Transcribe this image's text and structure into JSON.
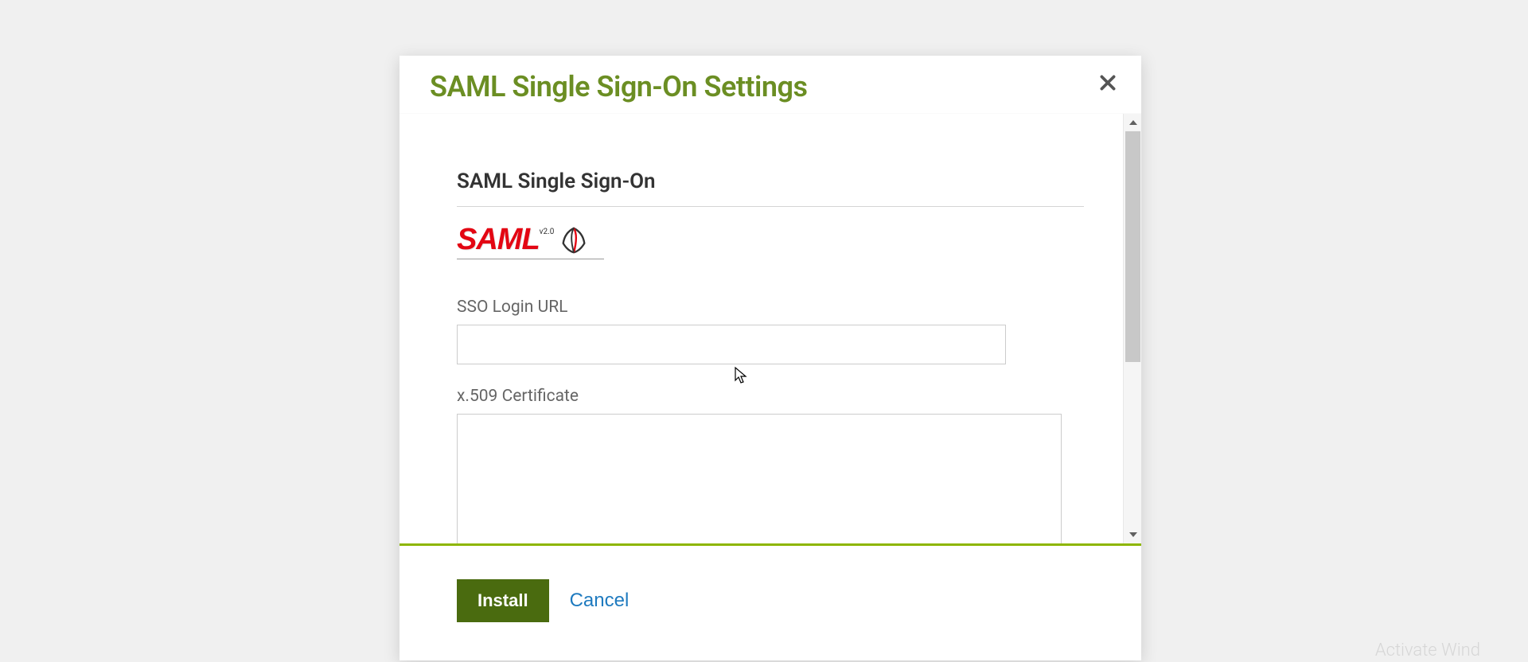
{
  "modal": {
    "title": "SAML Single Sign-On Settings",
    "section_title": "SAML Single Sign-On",
    "logo": {
      "text": "SAML",
      "version": "v2.0"
    },
    "fields": {
      "sso_url": {
        "label": "SSO Login URL",
        "value": ""
      },
      "certificate": {
        "label": "x.509 Certificate",
        "value": ""
      }
    },
    "buttons": {
      "install": "Install",
      "cancel": "Cancel"
    }
  },
  "watermark": "Activate Wind"
}
